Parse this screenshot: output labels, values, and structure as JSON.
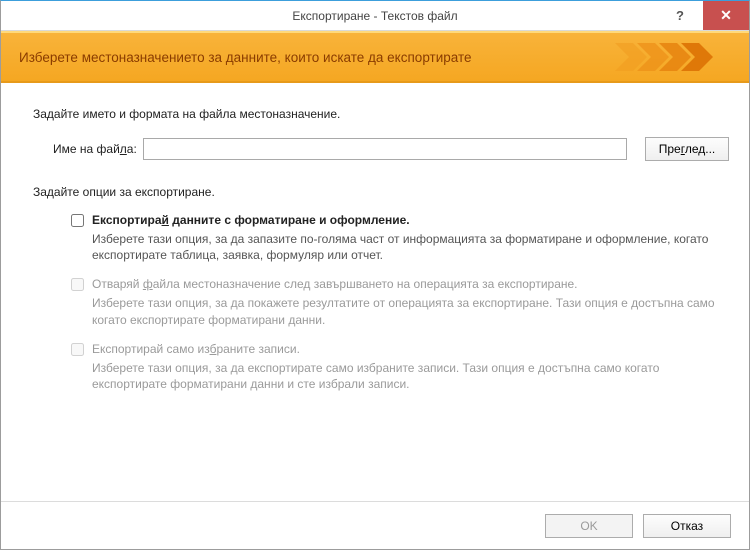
{
  "titlebar": {
    "title": "Експортиране - Текстов файл",
    "help_tooltip": "Help",
    "close_tooltip": "Close"
  },
  "banner": {
    "text": "Изберете местоназначението за данните, които искате да експортирате"
  },
  "body": {
    "dest_label": "Задайте името и формата на файла местоназначение.",
    "filename_label_before": "Име на фай",
    "filename_label_ul": "л",
    "filename_label_after": "а:",
    "filename_value": "",
    "browse_before": "Пре",
    "browse_ul": "г",
    "browse_after": "лед...",
    "options_label": "Задайте опции за експортиране.",
    "option1": {
      "title_before": "Експортира",
      "title_ul": "й",
      "title_after": " данните с форматиране и оформление.",
      "desc": "Изберете тази опция, за да запазите по-голяма част от информацията за форматиране и оформление, когато експортирате таблица, заявка, формуляр или отчет.",
      "checked": false,
      "enabled": true
    },
    "option2": {
      "title_before": "Отваряй ",
      "title_ul": "ф",
      "title_after": "айла местоназначение след завършването на операцията за експортиране.",
      "desc": "Изберете тази опция, за да покажете резултатите от операцията за експортиране. Тази опция е достъпна само когато експортирате форматирани данни.",
      "checked": false,
      "enabled": false
    },
    "option3": {
      "title_before": "Експортирай само из",
      "title_ul": "б",
      "title_after": "раните записи.",
      "desc": "Изберете тази опция, за да експортирате само избраните записи. Тази опция е достъпна само когато експортирате форматирани данни и сте избрали записи.",
      "checked": false,
      "enabled": false
    }
  },
  "footer": {
    "ok_label": "OK",
    "cancel_label": "Отказ"
  },
  "colors": {
    "banner_top": "#f8b33a",
    "banner_bottom": "#f5a722",
    "close_btn": "#c8504f"
  }
}
